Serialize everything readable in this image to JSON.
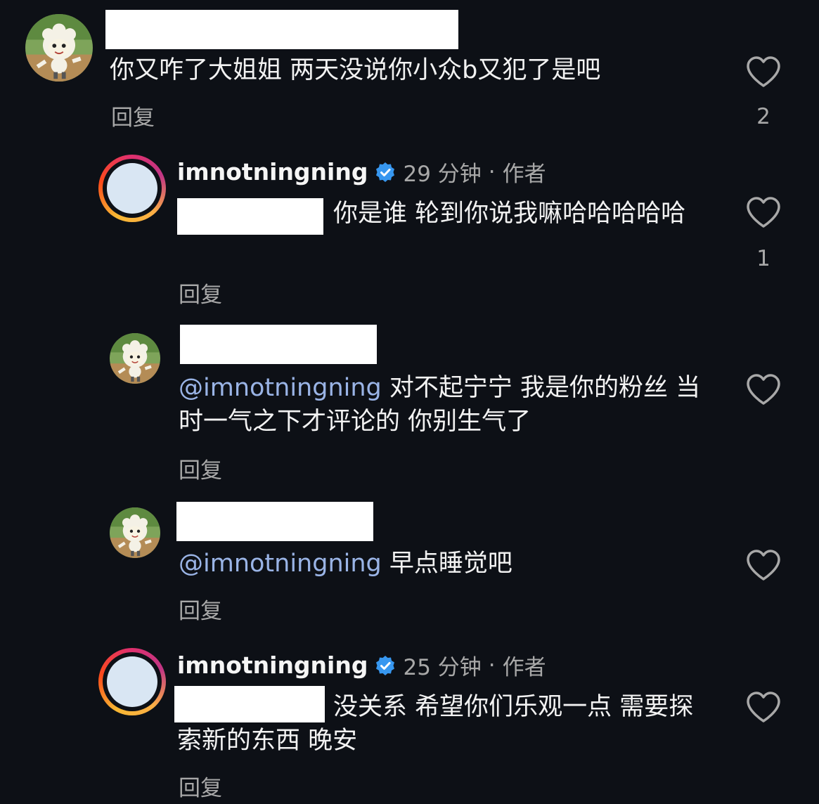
{
  "comments": [
    {
      "username": "",
      "text": "你又咋了大姐姐 两天没说你小众b又犯了是吧",
      "reply_label": "回复",
      "likes": "2"
    },
    {
      "username": "imnotningning",
      "time": "29 分钟",
      "separator": "·",
      "role": "作者",
      "text": "你是谁 轮到你说我嘛哈哈哈哈哈",
      "reply_label": "回复",
      "likes": "1"
    },
    {
      "username": "",
      "mention": "@imnotningning",
      "text": "对不起宁宁 我是你的粉丝 当时一气之下才评论的 你别生气了",
      "reply_label": "回复",
      "likes": ""
    },
    {
      "username": "",
      "mention": "@imnotningning",
      "text": "早点睡觉吧",
      "reply_label": "回复",
      "likes": ""
    },
    {
      "username": "imnotningning",
      "time": "25 分钟",
      "separator": "·",
      "role": "作者",
      "text": "没关系 希望你们乐观一点 需要探索新的东西 晚安",
      "reply_label": "回复",
      "likes": ""
    }
  ],
  "colors": {
    "background": "#0d1016",
    "mention": "#9ab4e6",
    "verified": "#3797f0",
    "muted": "#a8a8a8"
  },
  "icons": {
    "like": "heart-outline-icon",
    "verified": "verified-badge-icon"
  }
}
